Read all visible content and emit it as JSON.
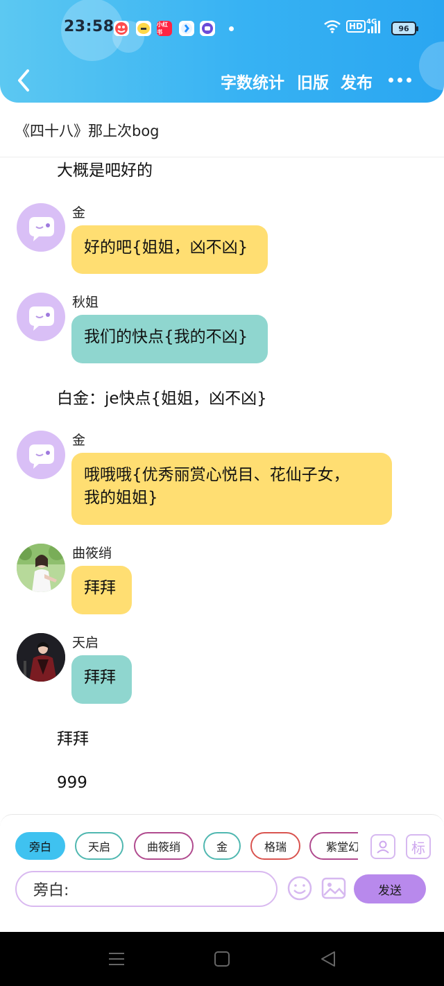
{
  "status_bar": {
    "time": "23:58",
    "battery": "96",
    "hd": "HD",
    "network": "4G",
    "apps": [
      {
        "name": "taobao-icon",
        "color": "#ff4d4d"
      },
      {
        "name": "app-yellow-icon",
        "color": "#ffd84a"
      },
      {
        "name": "xiaohongshu-icon",
        "color": "#ff2442",
        "label": "小红书"
      },
      {
        "name": "app-blue-icon",
        "color": "#1e90ff"
      },
      {
        "name": "app-purple-icon",
        "color": "#6b4bd8"
      }
    ]
  },
  "header": {
    "word_count": "字数统计",
    "old_version": "旧版",
    "publish": "发布"
  },
  "title": "《四十八》那上次bog",
  "messages": {
    "narr_1": "大概是吧好的",
    "m1": {
      "name": "金",
      "text": "好的吧{姐姐，凶不凶}"
    },
    "m2": {
      "name": "秋姐",
      "text": "我们的快点{我的不凶}"
    },
    "narr_2": "白金：je快点{姐姐，凶不凶}",
    "m3": {
      "name": "金",
      "line1": "哦哦哦{优秀丽赏心悦目、花仙子女，",
      "line2": "我的姐姐}"
    },
    "m4": {
      "name": "曲筱绡",
      "text": "拜拜"
    },
    "m5": {
      "name": "天启",
      "text": "拜拜"
    },
    "narr_3": "拜拜",
    "narr_4": "999"
  },
  "composer": {
    "chips": [
      "旁白",
      "天启",
      "曲筱绡",
      "金",
      "格瑞",
      "紫堂幻"
    ],
    "chip_colors": [
      "#3fc2f0",
      "#4fb7b0",
      "#b04a8e",
      "#4fb7b0",
      "#d9534f",
      "#b04a8e"
    ],
    "tag_label": "标",
    "input_value": "旁白:",
    "send": "发送"
  }
}
